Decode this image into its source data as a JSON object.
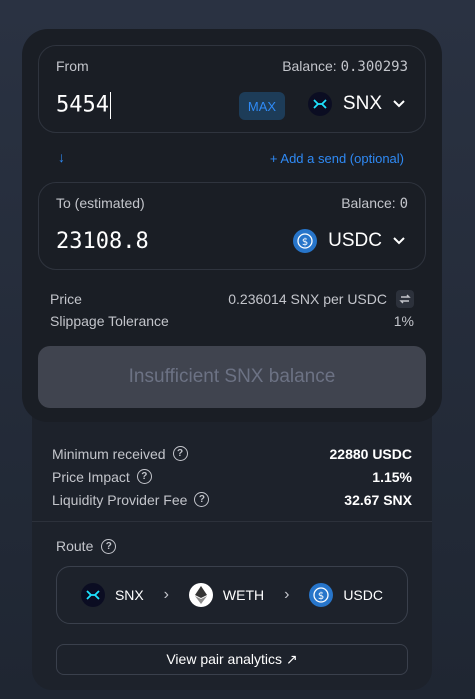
{
  "from": {
    "label": "From",
    "balance_label": "Balance:",
    "balance_value": "0.300293",
    "amount": "5454",
    "max_label": "MAX",
    "token": "SNX"
  },
  "add_send": "+ Add a send (optional)",
  "to": {
    "label": "To (estimated)",
    "balance_label": "Balance:",
    "balance_value": "0",
    "amount": "23108.8",
    "token": "USDC"
  },
  "price": {
    "label": "Price",
    "value": "0.236014 SNX per USDC"
  },
  "slippage": {
    "label": "Slippage Tolerance",
    "value": "1%"
  },
  "swap_button": "Insufficient SNX balance",
  "details": [
    {
      "label": "Minimum received",
      "value": "22880 USDC"
    },
    {
      "label": "Price Impact",
      "value": "1.15%"
    },
    {
      "label": "Liquidity Provider Fee",
      "value": "32.67 SNX"
    }
  ],
  "route": {
    "label": "Route",
    "hops": [
      "SNX",
      "WETH",
      "USDC"
    ]
  },
  "analytics_link": "View pair analytics ↗",
  "icons": {
    "snx": "snx-token-icon",
    "usdc": "usdc-token-icon",
    "weth": "weth-token-icon"
  },
  "colors": {
    "accent": "#2f8af5",
    "card": "#1a1e25",
    "disabled_button": "#40444f"
  }
}
